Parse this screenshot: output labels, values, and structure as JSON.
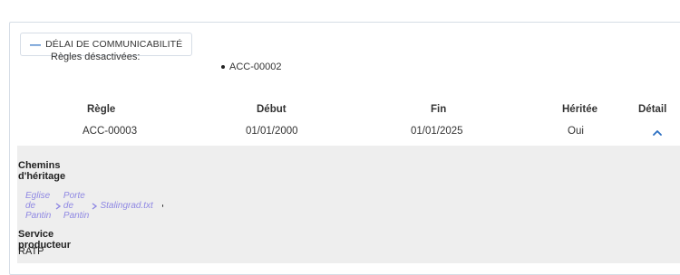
{
  "section": {
    "title": "DÉLAI DE COMMUNICABILITÉ",
    "collapse_symbol": "—"
  },
  "disabled_rules": {
    "label": "Règles désactivées:",
    "items": [
      "ACC-00002"
    ]
  },
  "table": {
    "headers": {
      "rule": "Règle",
      "start": "Début",
      "end": "Fin",
      "inherited": "Héritée",
      "detail": "Détail"
    },
    "rows": [
      {
        "rule": "ACC-00003",
        "start": "01/01/2000",
        "end": "01/01/2025",
        "inherited": "Oui",
        "detail_icon": "chevron-up-icon"
      }
    ]
  },
  "details": {
    "inheritance_title": "Chemins d'héritage",
    "path": [
      "Eglise de Pantin",
      "Porte de Pantin",
      "Stalingrad.txt"
    ],
    "service_title": "Service producteur",
    "service_value": "RATP"
  },
  "colors": {
    "accent": "#2b6fc2",
    "link": "#8f88e3",
    "panel_background": "#eeeeee",
    "border": "#d6dde6"
  }
}
